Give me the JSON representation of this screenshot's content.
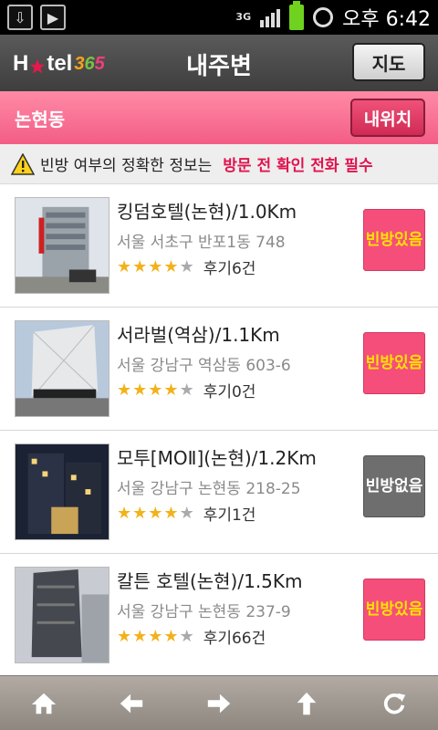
{
  "statusbar": {
    "network": "3G",
    "time": "오후 6:42"
  },
  "header": {
    "logo_text": "H tel",
    "logo_num": [
      "3",
      "6",
      "5"
    ],
    "title": "내주변",
    "map_button": "지도"
  },
  "location": {
    "label": "논현동",
    "my_location_button": "내위치"
  },
  "notice": {
    "text_a": "빈방 여부의 정확한 정보는",
    "text_b": "방문 전 확인 전화 필수"
  },
  "hotels": [
    {
      "name": "킹덤호텔(논현)/1.0Km",
      "address": "서울 서초구 반포1동 748",
      "stars": 4,
      "reviews": "후기6건",
      "vacancy": "빈방 있음",
      "vacancy_line1": "빈방",
      "vacancy_line2": "있음",
      "available": true
    },
    {
      "name": "서라벌(역삼)/1.1Km",
      "address": "서울 강남구 역삼동 603-6",
      "stars": 4,
      "reviews": "후기0건",
      "vacancy": "빈방 있음",
      "vacancy_line1": "빈방",
      "vacancy_line2": "있음",
      "available": true
    },
    {
      "name": "모투[MOⅡ](논현)/1.2Km",
      "address": "서울 강남구 논현동 218-25",
      "stars": 4,
      "reviews": "후기1건",
      "vacancy": "빈방 없음",
      "vacancy_line1": "빈방",
      "vacancy_line2": "없음",
      "available": false
    },
    {
      "name": "칼튼 호텔(논현)/1.5Km",
      "address": "서울 강남구 논현동 237-9",
      "stars": 4,
      "reviews": "후기66건",
      "vacancy": "빈방 있음",
      "vacancy_line1": "빈방",
      "vacancy_line2": "있음",
      "available": true
    }
  ],
  "bottom_nav": [
    "home-icon",
    "back-arrow-icon",
    "forward-arrow-icon",
    "up-arrow-icon",
    "refresh-icon"
  ],
  "colors": {
    "header_bg": "#4a4a4a",
    "location_bar": "#f76a8f",
    "vacancy_yes_bg": "#f54e7a",
    "vacancy_yes_text": "#ffe100",
    "vacancy_no_bg": "#6e6e6e",
    "notice_highlight": "#e0144f",
    "star": "#f3b21a"
  }
}
